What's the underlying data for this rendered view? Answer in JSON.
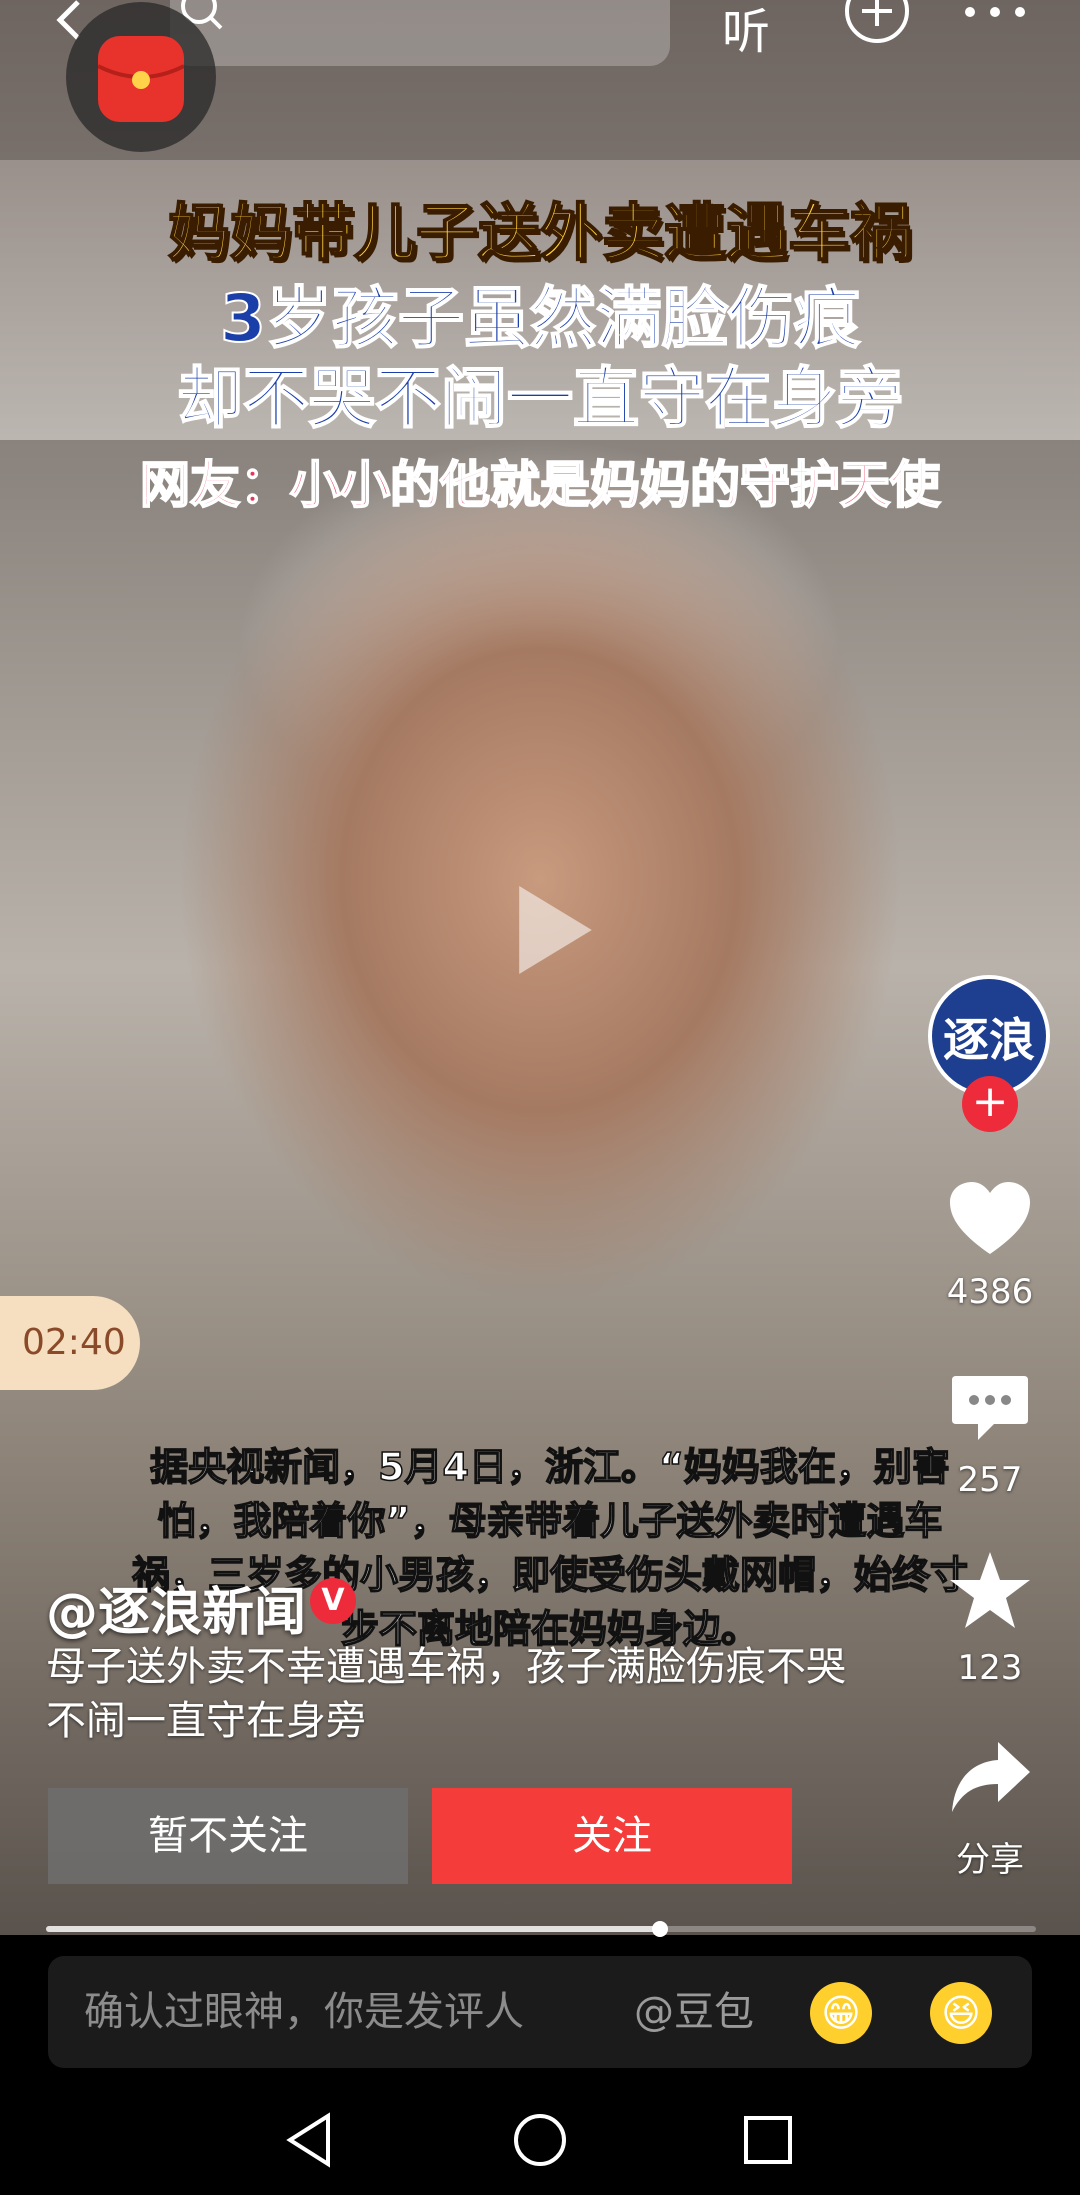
{
  "top_bar": {
    "listen_label": "听"
  },
  "video": {
    "caption_lines": [
      "妈妈带儿子送外卖遭遇车祸",
      "3岁孩子虽然满脸伤痕",
      "却不哭不闹一直守在身旁",
      "网友：小小的他就是妈妈的守护天使"
    ],
    "subtitle": "据央视新闻，5月4日，浙江。“妈妈我在，别害怕，我陪着你”，母亲带着儿子送外卖时遭遇车祸，三岁多的小男孩，即使受伤头戴网帽，始终寸步不离地陪在妈妈身边。",
    "timer": "02:40",
    "progress_fraction": 0.62
  },
  "author": {
    "name": "@逐浪新闻",
    "avatar_text": "逐浪",
    "verified_mark": "V"
  },
  "post": {
    "description": "母子送外卖不幸遭遇车祸，孩子满脸伤痕不哭不闹一直守在身旁"
  },
  "actions": {
    "likes": "4386",
    "comments": "257",
    "favorites": "123",
    "share_label": "分享"
  },
  "follow_prompt": {
    "unfollow_label": "暂不关注",
    "follow_label": "关注"
  },
  "comment_bar": {
    "placeholder": "确认过眼神，你是发评人",
    "mention": "@豆包",
    "emoji_1": "😁",
    "emoji_2": "😆"
  },
  "icons": {
    "like": "heart-icon",
    "comment": "comment-icon",
    "favorite": "star-icon",
    "share": "share-icon",
    "play": "play-icon"
  },
  "colors": {
    "follow_red": "#f43c3a",
    "timer_bg": "#f5dfc0",
    "avatar_blue": "#1e3f8f"
  }
}
